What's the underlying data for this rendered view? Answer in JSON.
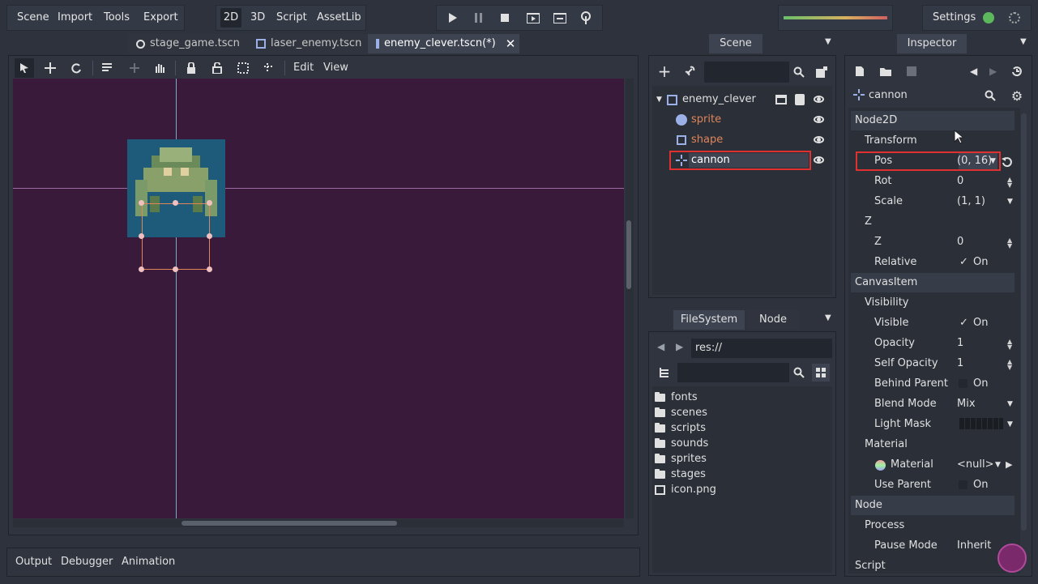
{
  "menu": {
    "scene": "Scene",
    "import": "Import",
    "tools": "Tools",
    "export": "Export"
  },
  "modes": {
    "m2d": "2D",
    "m3d": "3D",
    "script": "Script",
    "assetlib": "AssetLib"
  },
  "settings": "Settings",
  "tabs": [
    {
      "label": "stage_game.tscn"
    },
    {
      "label": "laser_enemy.tscn"
    },
    {
      "label": "enemy_clever.tscn(*)"
    }
  ],
  "viewport": {
    "edit": "Edit",
    "view": "View"
  },
  "scene_dock": {
    "title": "Scene",
    "nodes": [
      {
        "name": "enemy_clever"
      },
      {
        "name": "sprite"
      },
      {
        "name": "shape"
      },
      {
        "name": "cannon"
      }
    ]
  },
  "fs_dock": {
    "tab_fs": "FileSystem",
    "tab_node": "Node",
    "path": "res://",
    "items": [
      "fonts",
      "scenes",
      "scripts",
      "sounds",
      "sprites",
      "stages",
      "icon.png"
    ]
  },
  "inspector": {
    "title": "Inspector",
    "node": "cannon",
    "rows": {
      "node2d": "Node2D",
      "transform": "Transform",
      "pos_label": "Pos",
      "pos_value": "(0, 16)",
      "rot_label": "Rot",
      "rot_value": "0",
      "scale_label": "Scale",
      "scale_value": "(1, 1)",
      "z_group": "Z",
      "z_label": "Z",
      "z_value": "0",
      "relative_label": "Relative",
      "relative_value": "On",
      "canvasitem": "CanvasItem",
      "visibility": "Visibility",
      "visible_label": "Visible",
      "visible_value": "On",
      "opacity_label": "Opacity",
      "opacity_value": "1",
      "selfopacity_label": "Self Opacity",
      "selfopacity_value": "1",
      "behind_label": "Behind Parent",
      "behind_value": "On",
      "blend_label": "Blend Mode",
      "blend_value": "Mix",
      "lightmask_label": "Light Mask",
      "material_group": "Material",
      "material_label": "Material",
      "material_value": "<null>",
      "useparent_label": "Use Parent",
      "useparent_value": "On",
      "node": "Node",
      "process": "Process",
      "pause_label": "Pause Mode",
      "pause_value": "Inherit",
      "script": "Script"
    }
  },
  "bottom": {
    "output": "Output",
    "debugger": "Debugger",
    "animation": "Animation"
  },
  "colors": {
    "accent": "#e0e0e0",
    "highlight": "#e03030",
    "canvas": "#3a1a3a",
    "orange": "#e0855a"
  }
}
